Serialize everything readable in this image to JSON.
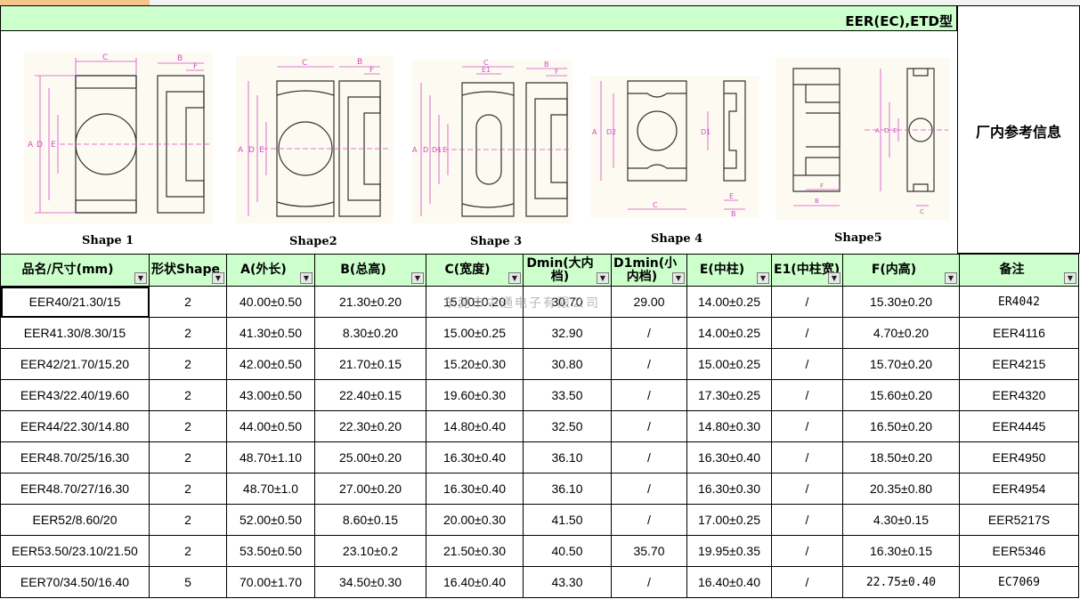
{
  "title": "EER(EC),ETD型",
  "ref_info": "厂内参考信息",
  "shapes": [
    {
      "label": "Shape 1"
    },
    {
      "label": "Shape2"
    },
    {
      "label": "Shape 3"
    },
    {
      "label": "Shape 4"
    },
    {
      "label": "Shape5"
    }
  ],
  "columns": [
    {
      "label": "品名/尺寸(mm)"
    },
    {
      "label": "形状Shape"
    },
    {
      "label": "A(外长)"
    },
    {
      "label": "B(总高)"
    },
    {
      "label": "C(宽度)"
    },
    {
      "label": "Dmin(大内档)"
    },
    {
      "label": "D1min(小内档)"
    },
    {
      "label": "E(中柱)"
    },
    {
      "label": "E1(中柱宽)"
    },
    {
      "label": "F(内高)"
    },
    {
      "label": "备注"
    }
  ],
  "rows": [
    [
      "EER40/21.30/15",
      "2",
      "40.00±0.50",
      "21.30±0.20",
      "15.00±0.20",
      "30.70",
      "29.00",
      "14.00±0.25",
      "/",
      "15.30±0.20",
      "ER4042"
    ],
    [
      "EER41.30/8.30/15",
      "2",
      "41.30±0.50",
      "8.30±0.20",
      "15.00±0.25",
      "32.90",
      "/",
      "14.00±0.25",
      "/",
      "4.70±0.20",
      "EER4116"
    ],
    [
      "EER42/21.70/15.20",
      "2",
      "42.00±0.50",
      "21.70±0.15",
      "15.20±0.30",
      "30.80",
      "/",
      "15.00±0.25",
      "/",
      "15.70±0.20",
      "EER4215"
    ],
    [
      "EER43/22.40/19.60",
      "2",
      "43.00±0.50",
      "22.40±0.15",
      "19.60±0.30",
      "33.50",
      "/",
      "17.30±0.25",
      "/",
      "15.60±0.20",
      "EER4320"
    ],
    [
      "EER44/22.30/14.80",
      "2",
      "44.00±0.50",
      "22.30±0.20",
      "14.80±0.40",
      "32.50",
      "/",
      "14.80±0.30",
      "/",
      "16.50±0.20",
      "EER4445"
    ],
    [
      "EER48.70/25/16.30",
      "2",
      "48.70±1.10",
      "25.00±0.20",
      "16.30±0.40",
      "36.10",
      "/",
      "16.30±0.40",
      "/",
      "18.50±0.20",
      "EER4950"
    ],
    [
      "EER48.70/27/16.30",
      "2",
      "48.70±1.0",
      "27.00±0.20",
      "16.30±0.40",
      "36.10",
      "/",
      "16.30±0.30",
      "/",
      "20.35±0.80",
      "EER4954"
    ],
    [
      "EER52/8.60/20",
      "2",
      "52.00±0.50",
      "8.60±0.15",
      "20.00±0.30",
      "41.50",
      "/",
      "17.00±0.25",
      "/",
      "4.30±0.15",
      "EER5217S"
    ],
    [
      "EER53.50/23.10/21.50",
      "2",
      "53.50±0.50",
      "23.10±0.2",
      "21.50±0.30",
      "40.50",
      "35.70",
      "19.95±0.35",
      "/",
      "16.30±0.15",
      "EER5346"
    ],
    [
      "EER70/34.50/16.40",
      "5",
      "70.00±1.70",
      "34.50±0.30",
      "16.40±0.40",
      "43.30",
      "/",
      "16.40±0.40",
      "/",
      "22.75±0.40",
      "EC7069"
    ]
  ],
  "watermark": "东莞市中通电子有限公司"
}
